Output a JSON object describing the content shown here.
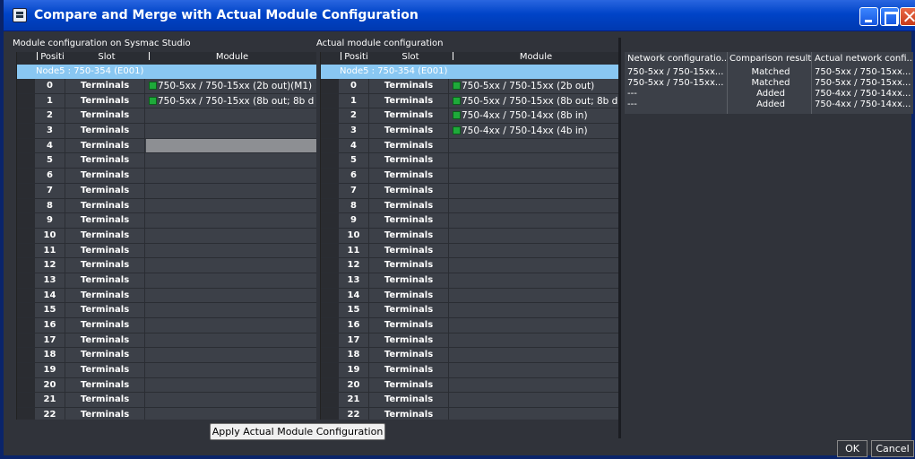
{
  "window": {
    "title": "Compare and Merge with Actual Module Configuration"
  },
  "left_panel": {
    "label": "Module configuration on Sysmac Studio",
    "headers": {
      "position": "Positi",
      "slot": "Slot",
      "module": "Module"
    },
    "node": "Node5 : 750-354 (E001)",
    "rows": [
      {
        "pos": "0",
        "slot": "Terminals",
        "module": "750-5xx / 750-15xx (2b out)(M1)",
        "icon": "module-icon"
      },
      {
        "pos": "1",
        "slot": "Terminals",
        "module": "750-5xx / 750-15xx (8b out; 8b d",
        "icon": "module-icon"
      },
      {
        "pos": "2",
        "slot": "Terminals",
        "module": ""
      },
      {
        "pos": "3",
        "slot": "Terminals",
        "module": ""
      },
      {
        "pos": "4",
        "slot": "Terminals",
        "module": "",
        "selected": true
      },
      {
        "pos": "5",
        "slot": "Terminals",
        "module": ""
      },
      {
        "pos": "6",
        "slot": "Terminals",
        "module": ""
      },
      {
        "pos": "7",
        "slot": "Terminals",
        "module": ""
      },
      {
        "pos": "8",
        "slot": "Terminals",
        "module": ""
      },
      {
        "pos": "9",
        "slot": "Terminals",
        "module": ""
      },
      {
        "pos": "10",
        "slot": "Terminals",
        "module": ""
      },
      {
        "pos": "11",
        "slot": "Terminals",
        "module": ""
      },
      {
        "pos": "12",
        "slot": "Terminals",
        "module": ""
      },
      {
        "pos": "13",
        "slot": "Terminals",
        "module": ""
      },
      {
        "pos": "14",
        "slot": "Terminals",
        "module": ""
      },
      {
        "pos": "15",
        "slot": "Terminals",
        "module": ""
      },
      {
        "pos": "16",
        "slot": "Terminals",
        "module": ""
      },
      {
        "pos": "17",
        "slot": "Terminals",
        "module": ""
      },
      {
        "pos": "18",
        "slot": "Terminals",
        "module": ""
      },
      {
        "pos": "19",
        "slot": "Terminals",
        "module": ""
      },
      {
        "pos": "20",
        "slot": "Terminals",
        "module": ""
      },
      {
        "pos": "21",
        "slot": "Terminals",
        "module": ""
      },
      {
        "pos": "22",
        "slot": "Terminals",
        "module": ""
      }
    ]
  },
  "right_panel": {
    "label": "Actual module configuration",
    "headers": {
      "position": "Positi",
      "slot": "Slot",
      "module": "Module"
    },
    "node": "Node5 : 750-354 (E001)",
    "rows": [
      {
        "pos": "0",
        "slot": "Terminals",
        "module": "750-5xx / 750-15xx (2b out)",
        "icon": "module-icon"
      },
      {
        "pos": "1",
        "slot": "Terminals",
        "module": "750-5xx / 750-15xx (8b out; 8b d",
        "icon": "module-icon"
      },
      {
        "pos": "2",
        "slot": "Terminals",
        "module": "750-4xx / 750-14xx (8b in)",
        "icon": "module-icon"
      },
      {
        "pos": "3",
        "slot": "Terminals",
        "module": "750-4xx / 750-14xx (4b in)",
        "icon": "module-icon"
      },
      {
        "pos": "4",
        "slot": "Terminals",
        "module": ""
      },
      {
        "pos": "5",
        "slot": "Terminals",
        "module": ""
      },
      {
        "pos": "6",
        "slot": "Terminals",
        "module": ""
      },
      {
        "pos": "7",
        "slot": "Terminals",
        "module": ""
      },
      {
        "pos": "8",
        "slot": "Terminals",
        "module": ""
      },
      {
        "pos": "9",
        "slot": "Terminals",
        "module": ""
      },
      {
        "pos": "10",
        "slot": "Terminals",
        "module": ""
      },
      {
        "pos": "11",
        "slot": "Terminals",
        "module": ""
      },
      {
        "pos": "12",
        "slot": "Terminals",
        "module": ""
      },
      {
        "pos": "13",
        "slot": "Terminals",
        "module": ""
      },
      {
        "pos": "14",
        "slot": "Terminals",
        "module": ""
      },
      {
        "pos": "15",
        "slot": "Terminals",
        "module": ""
      },
      {
        "pos": "16",
        "slot": "Terminals",
        "module": ""
      },
      {
        "pos": "17",
        "slot": "Terminals",
        "module": ""
      },
      {
        "pos": "18",
        "slot": "Terminals",
        "module": ""
      },
      {
        "pos": "19",
        "slot": "Terminals",
        "module": ""
      },
      {
        "pos": "20",
        "slot": "Terminals",
        "module": ""
      },
      {
        "pos": "21",
        "slot": "Terminals",
        "module": ""
      },
      {
        "pos": "22",
        "slot": "Terminals",
        "module": ""
      }
    ]
  },
  "comparison": {
    "headers": [
      "Network configuratio...",
      "Comparison result",
      "Actual network confi..."
    ],
    "rows": [
      [
        "750-5xx / 750-15xx...",
        "Matched",
        "750-5xx / 750-15xx..."
      ],
      [
        "750-5xx / 750-15xx...",
        "Matched",
        "750-5xx / 750-15xx..."
      ],
      [
        "---",
        "Added",
        "750-4xx / 750-14xx..."
      ],
      [
        "---",
        "Added",
        "750-4xx / 750-14xx..."
      ]
    ]
  },
  "buttons": {
    "apply": "Apply Actual Module Configuration",
    "ok": "OK",
    "cancel": "Cancel"
  },
  "colors": {
    "title_bar": "#0044c8",
    "node_row": "#89c7f2",
    "module_icon": "#1eaa3a"
  }
}
